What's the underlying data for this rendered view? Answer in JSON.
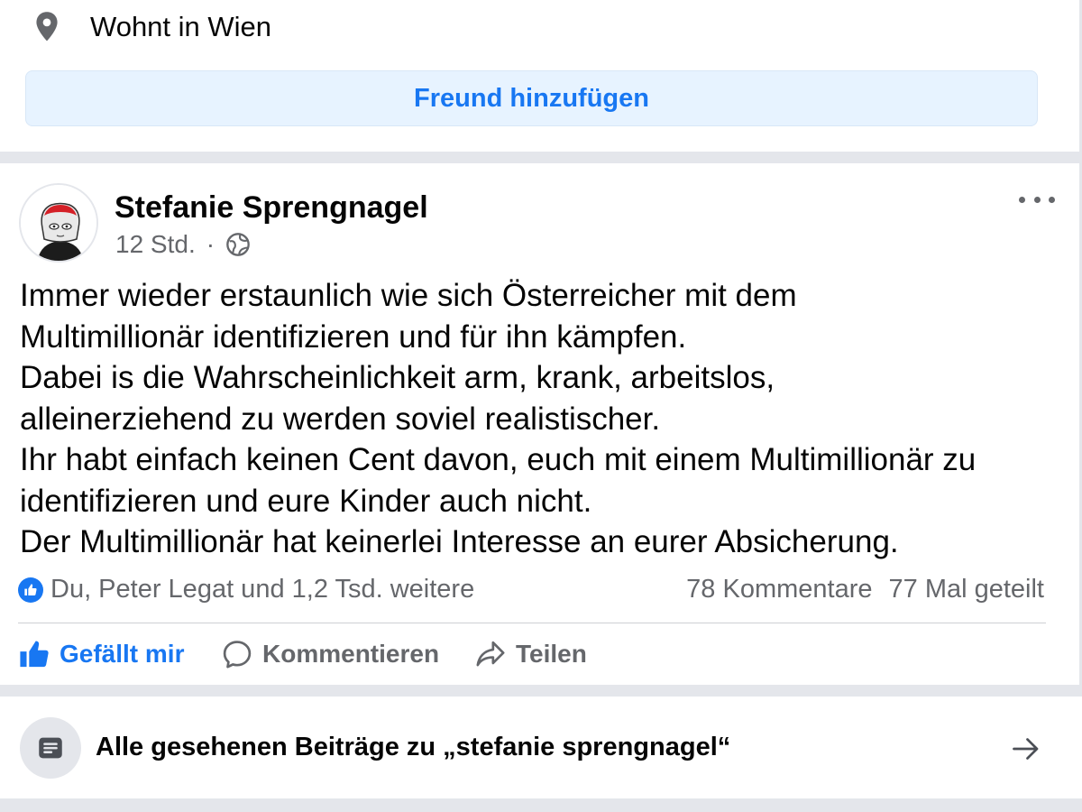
{
  "profile": {
    "location_text": "Wohnt in Wien",
    "add_friend_label": "Freund hinzufügen"
  },
  "post": {
    "author": "Stefanie Sprengnagel",
    "time": "12 Std.",
    "separator": "·",
    "text_lines": [
      "Immer wieder erstaunlich wie sich Österreicher mit dem",
      "Multimillionär identifizieren und für ihn kämpfen.",
      "Dabei is die Wahrscheinlichkeit arm, krank, arbeitslos,",
      "alleinerziehend zu werden soviel realistischer.",
      "Ihr habt einfach keinen Cent davon, euch mit einem Multimillionär zu",
      "identifizieren und eure Kinder auch nicht.",
      "Der Multimillionär hat keinerlei Interesse an eurer Absicherung."
    ],
    "reactions_text": "Du, Peter Legat und 1,2 Tsd. weitere",
    "comments_count": "78 Kommentare",
    "shares_count": "77 Mal geteilt",
    "actions": {
      "like": "Gefällt mir",
      "comment": "Kommentieren",
      "share": "Teilen"
    }
  },
  "footer": {
    "all_posts_label": "Alle gesehenen Beiträge zu „stefanie sprengnagel“"
  },
  "colors": {
    "accent": "#1877f2",
    "button_bg": "#e7f3ff",
    "secondary_text": "#65676b",
    "separator": "#e4e6eb"
  },
  "icons": {
    "location": "map-pin-icon",
    "privacy": "globe-icon",
    "more": "more-horizontal-icon",
    "like": "thumbs-up-icon",
    "comment": "comment-icon",
    "share": "share-icon",
    "document": "document-icon",
    "arrow": "arrow-right-icon"
  }
}
